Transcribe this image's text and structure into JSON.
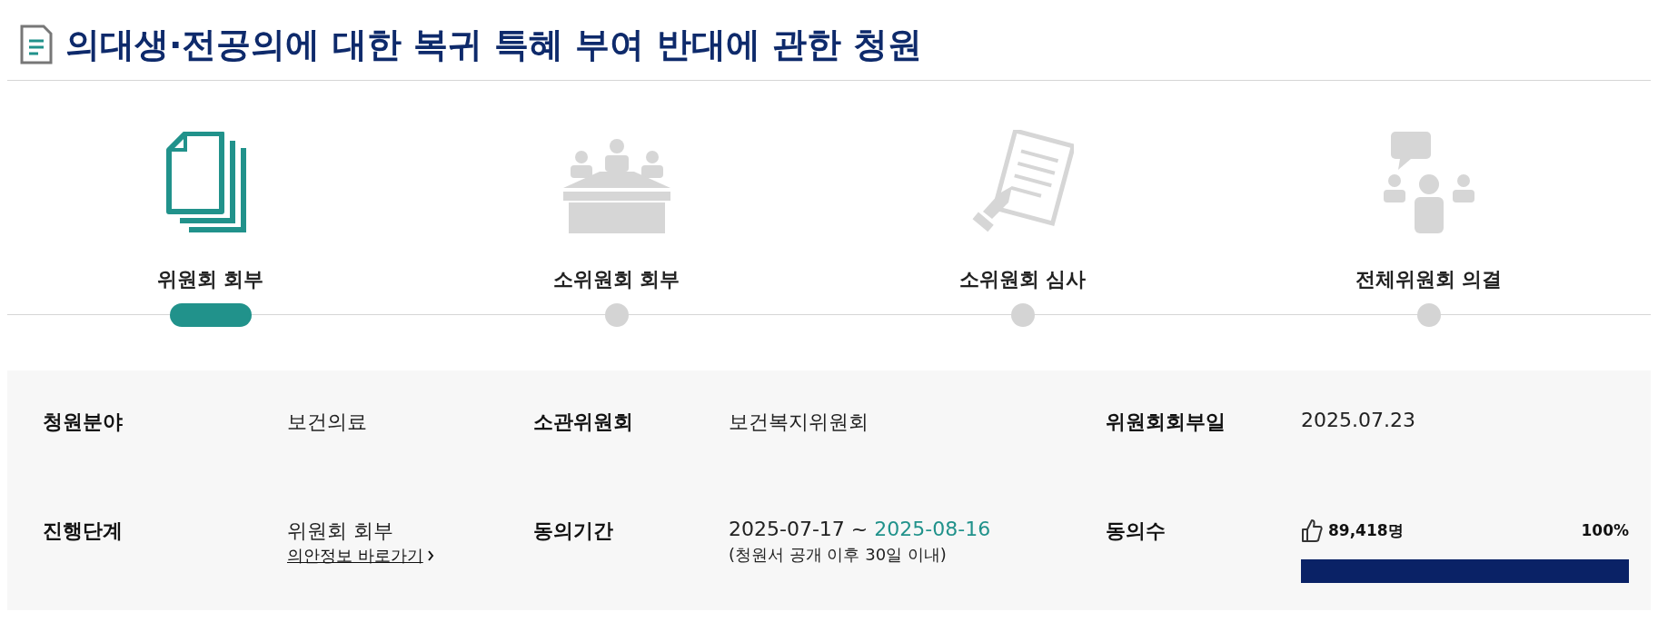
{
  "title": "의대생·전공의에 대한 복귀 특혜 부여 반대에 관한 청원",
  "steps": [
    {
      "kind": "documents",
      "label": "위원회 회부",
      "selected": true
    },
    {
      "kind": "meeting",
      "label": "소위원회 회부",
      "selected": false
    },
    {
      "kind": "review",
      "label": "소위원회 심사",
      "selected": false
    },
    {
      "kind": "discussion",
      "label": "전체위원회 의결",
      "selected": false
    }
  ],
  "info": {
    "field_label": "청원분야",
    "field": "보건의료",
    "committee_label": "소관위원회",
    "committee": "보건복지위원회",
    "referral_date_label": "위원회회부일",
    "referral_date": "2025.07.23",
    "stage_label": "진행단계",
    "stage": "위원회 회부",
    "stage_link": "의안정보 바로가기",
    "period_label": "동의기간",
    "period_start": "2025-07-17 ~",
    "period_end": "2025-08-16",
    "period_note": "(청원서 공개 이후 30일 이내)",
    "consent_label": "동의수",
    "consent_count": "89,418명",
    "consent_percent": "100%",
    "level": 1
  }
}
